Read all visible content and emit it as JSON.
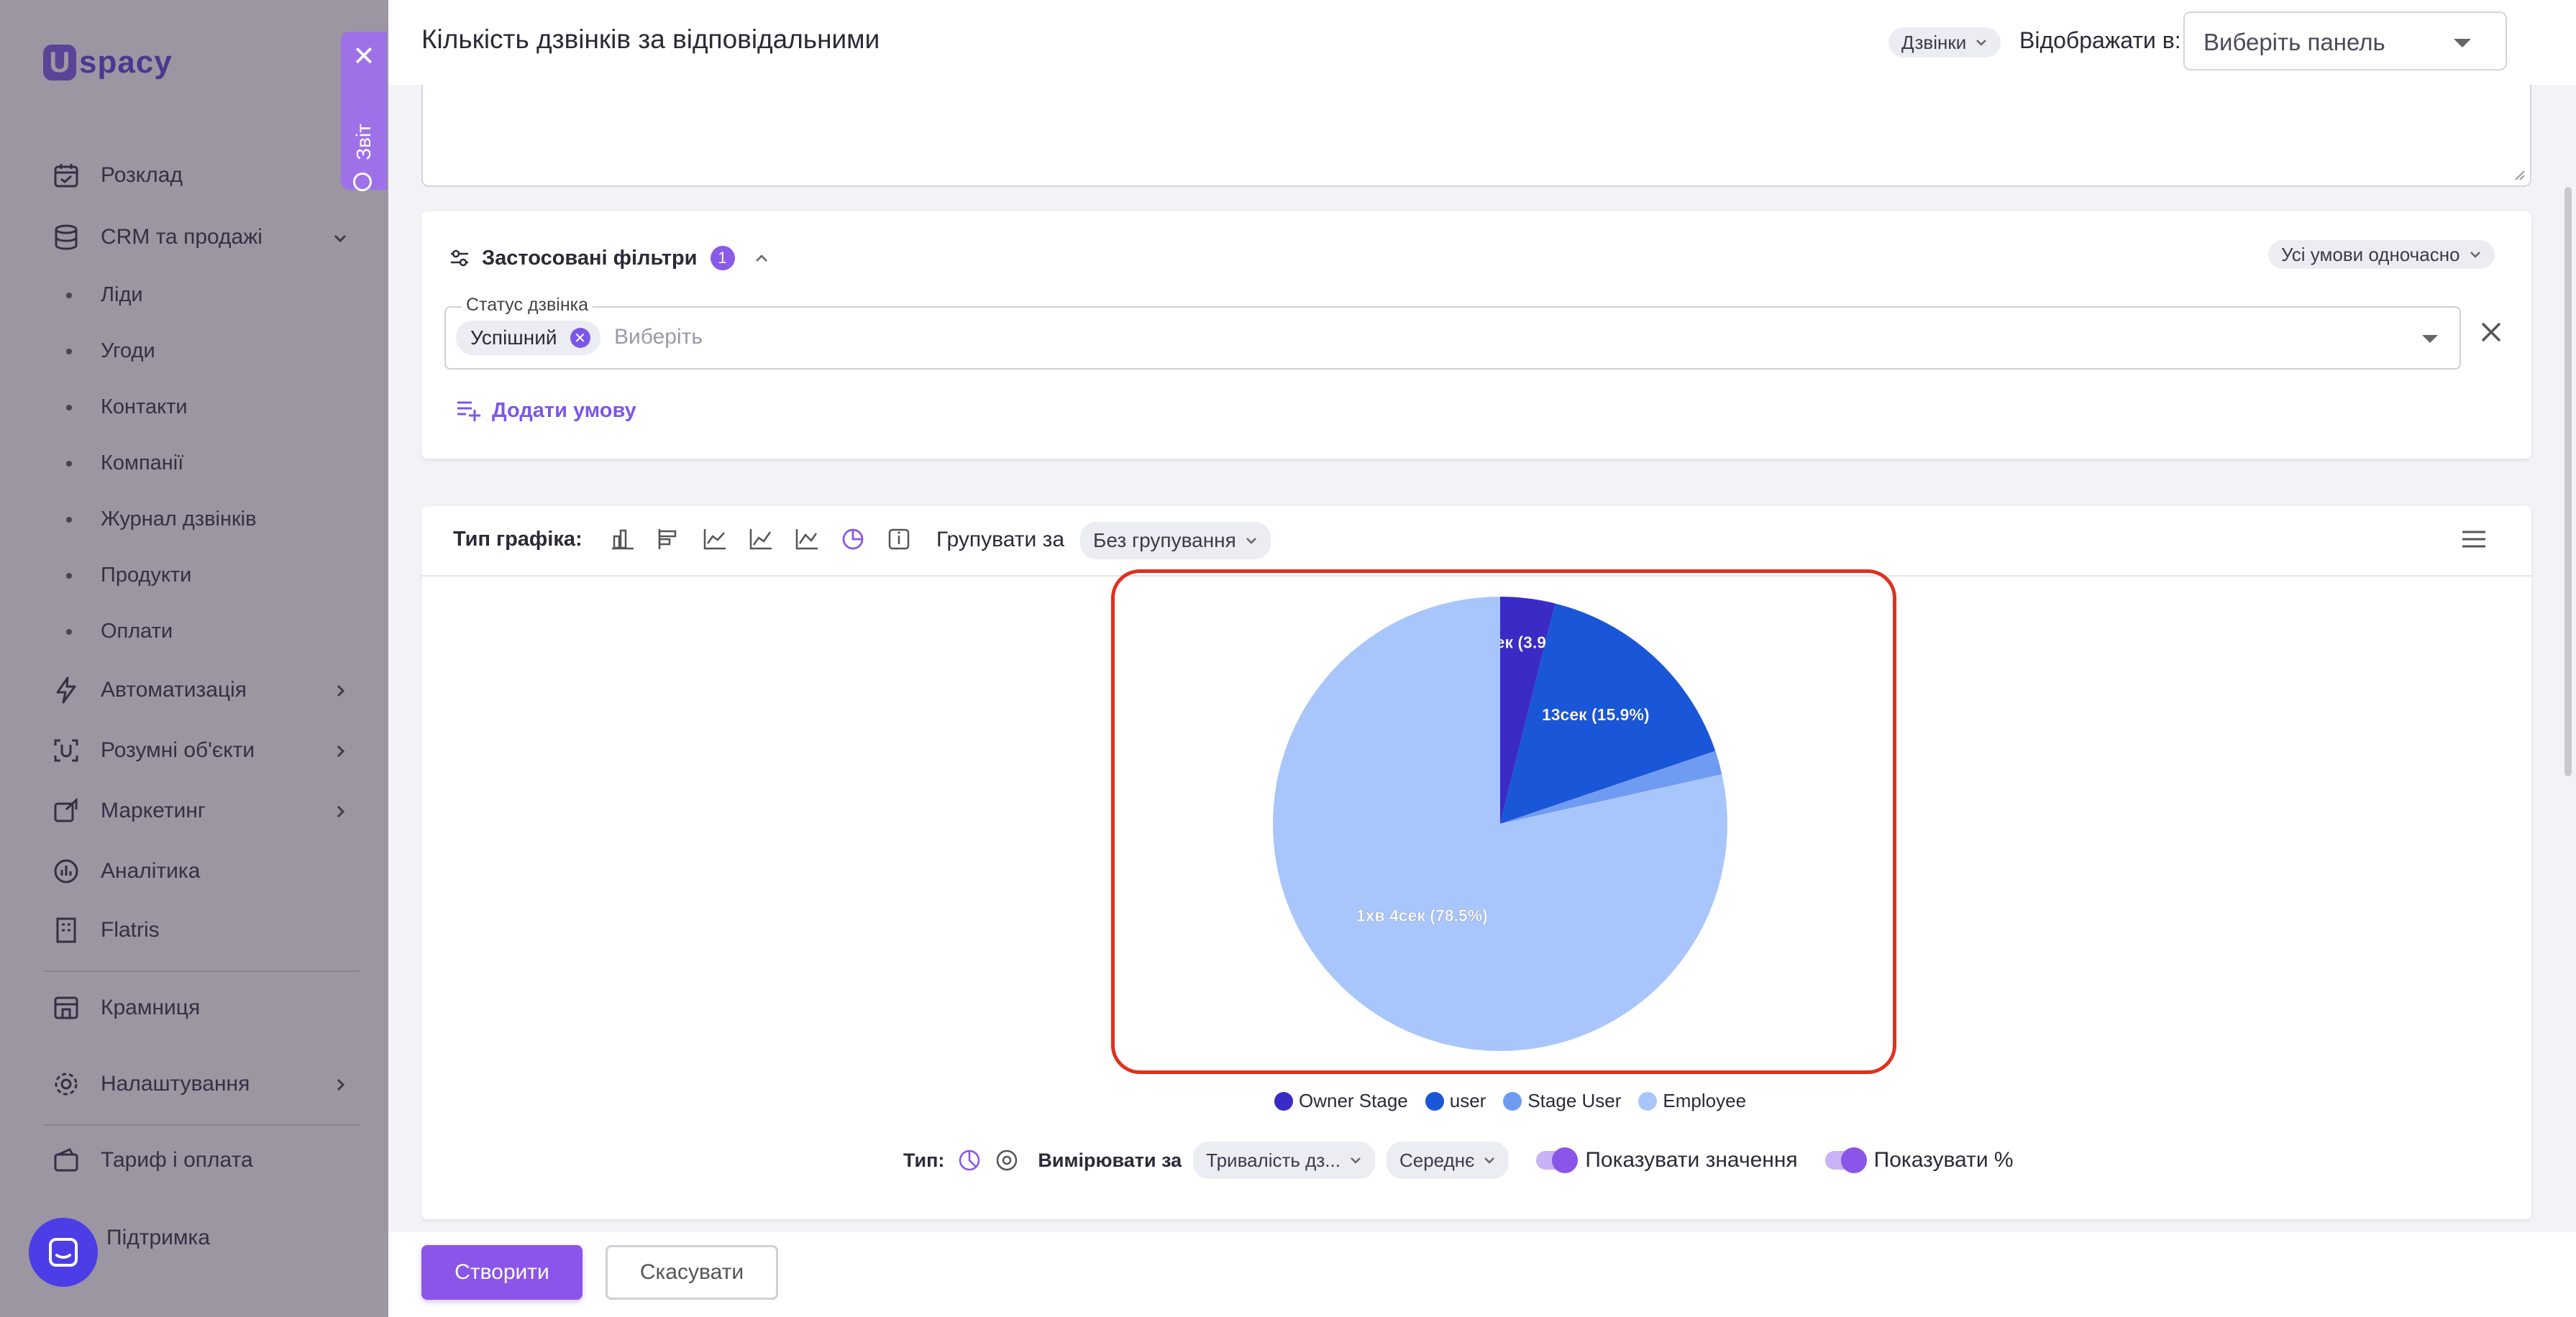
{
  "sidebar": {
    "logo": "U spacy",
    "items": [
      {
        "label": "Розклад",
        "icon": "calendar-icon"
      },
      {
        "label": "CRM та продажі",
        "icon": "database-icon"
      },
      {
        "label": "Автоматизація",
        "icon": "lightning-icon"
      },
      {
        "label": "Розумні об'єкти",
        "icon": "scan-icon"
      },
      {
        "label": "Маркетинг",
        "icon": "megaphone-icon"
      },
      {
        "label": "Аналітика",
        "icon": "chart-icon"
      },
      {
        "label": "Flatris",
        "icon": "building-icon"
      },
      {
        "label": "Крамниця",
        "icon": "store-icon"
      },
      {
        "label": "Налаштування",
        "icon": "gear-icon"
      },
      {
        "label": "Тариф і оплата",
        "icon": "wallet-icon"
      },
      {
        "label": "Підтримка",
        "icon": "support-icon"
      }
    ],
    "crm_sub": [
      "Ліди",
      "Угоди",
      "Контакти",
      "Компанії",
      "Журнал дзвінків",
      "Продукти",
      "Оплати"
    ]
  },
  "report_tab": {
    "label": "Звіт"
  },
  "header": {
    "title": "Кількість дзвінків за відповідальними",
    "source_pill": "Дзвінки",
    "show_in_label": "Відображати в:",
    "panel_select": "Виберіть панель"
  },
  "filters": {
    "title": "Застосовані фільтри",
    "count": "1",
    "all_conditions": "Усі умови одночасно",
    "status_label": "Статус дзвінка",
    "status_chip": "Успішний",
    "status_placeholder": "Виберіть",
    "add_condition": "Додати умову"
  },
  "chart_toolbar": {
    "type_label": "Тип графіка:",
    "group_label": "Групувати за",
    "group_value": "Без групування"
  },
  "chart_data": {
    "type": "pie",
    "slices": [
      {
        "name": "Owner Stage",
        "value": 3.9,
        "label": "3сек (3.9%)",
        "color": "#3b2bc6"
      },
      {
        "name": "user",
        "value": 15.9,
        "label": "13сек (15.9%)",
        "color": "#1a56d8"
      },
      {
        "name": "Stage User",
        "value": 1.7,
        "label": "",
        "color": "#6f9cf2"
      },
      {
        "name": "Employee",
        "value": 78.5,
        "label": "1хв 4сек (78.5%)",
        "color": "#a8c6fb"
      }
    ]
  },
  "controls": {
    "type_label": "Тип:",
    "measure_label": "Вимірювати за",
    "measure_value": "Тривалість дз...",
    "agg_value": "Середнє",
    "show_values": "Показувати значення",
    "show_percent": "Показувати %"
  },
  "footer": {
    "create": "Створити",
    "cancel": "Скасувати"
  }
}
